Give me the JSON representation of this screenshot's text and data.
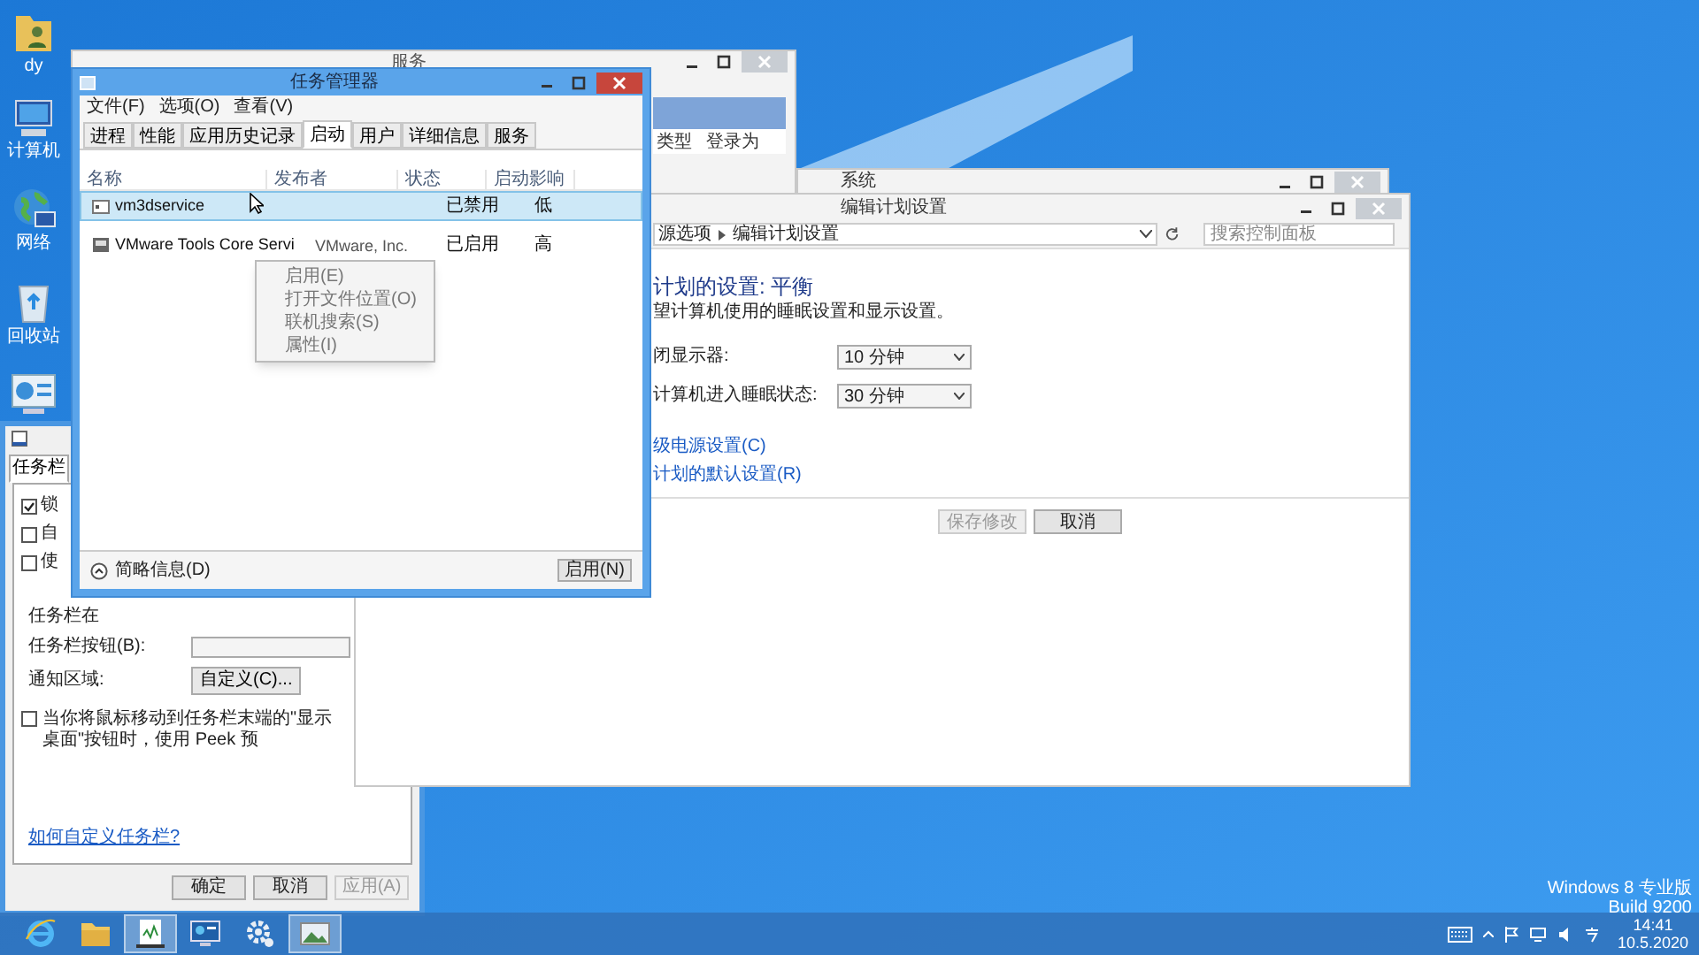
{
  "desktop_icons": [
    {
      "kind": "user-folder",
      "label": "dy"
    },
    {
      "kind": "computer",
      "label": "计算机"
    },
    {
      "kind": "network",
      "label": "网络"
    },
    {
      "kind": "recycle-bin",
      "label": "回收站"
    },
    {
      "kind": "control-panel"
    }
  ],
  "services_window": {
    "title": "服务",
    "columns": [
      "类型",
      "登录为"
    ]
  },
  "system_window": {
    "title": "系统"
  },
  "taskbar_properties": {
    "tabs": [
      {
        "label": "任务栏",
        "selected": true
      }
    ],
    "checkboxes": [
      {
        "label": "锁",
        "checked": true
      },
      {
        "label": "自",
        "checked": false
      },
      {
        "label": "使",
        "checked": false
      }
    ],
    "rows": [
      {
        "label": "任务栏在"
      },
      {
        "label": "任务栏按钮(B):"
      },
      {
        "label": "通知区域:",
        "button": "自定义(C)..."
      }
    ],
    "peek": {
      "label": "当你将鼠标移动到任务栏末端的\"显示桌面\"按钮时，使用 Peek 预",
      "checked": false
    },
    "link": "如何自定义任务栏?",
    "buttons": [
      {
        "label": "确定",
        "disabled": false
      },
      {
        "label": "取消",
        "disabled": false
      },
      {
        "label": "应用(A)",
        "disabled": true
      }
    ]
  },
  "power_window": {
    "title": "编辑计划设置",
    "breadcrumb": [
      "源选项",
      "编辑计划设置"
    ],
    "search": {
      "placeholder": "搜索控制面板"
    },
    "heading": "计划的设置: 平衡",
    "description": "望计算机使用的睡眠设置和显示设置。",
    "settings": [
      {
        "label": "闭显示器:",
        "value": "10 分钟"
      },
      {
        "label": "计算机进入睡眠状态:",
        "value": "30 分钟"
      }
    ],
    "links": [
      "级电源设置(C)",
      "计划的默认设置(R)"
    ],
    "buttons": [
      {
        "label": "保存修改",
        "disabled": true
      },
      {
        "label": "取消",
        "disabled": false
      }
    ]
  },
  "task_manager": {
    "title": "任务管理器",
    "menu": [
      "文件(F)",
      "选项(O)",
      "查看(V)"
    ],
    "tabs": [
      {
        "label": "进程",
        "selected": false
      },
      {
        "label": "性能",
        "selected": false
      },
      {
        "label": "应用历史记录",
        "selected": false
      },
      {
        "label": "启动",
        "selected": true
      },
      {
        "label": "用户",
        "selected": false
      },
      {
        "label": "详细信息",
        "selected": false
      },
      {
        "label": "服务",
        "selected": false
      }
    ],
    "columns": [
      "名称",
      "发布者",
      "状态",
      "启动影响"
    ],
    "rows": [
      {
        "kind": "generic",
        "name": "vm3dservice",
        "status": "已禁用",
        "impact": "低",
        "selected": true
      },
      {
        "kind": "vmware",
        "name": "VMware Tools Core Servi",
        "publisher": "VMware, Inc.",
        "status": "已启用",
        "impact": "高",
        "selected": false
      }
    ],
    "context_menu": [
      "启用(E)",
      "打开文件位置(O)",
      "联机搜索(S)",
      "属性(I)"
    ],
    "details_toggle": "简略信息(D)",
    "action_button": "启用(N)"
  },
  "os_label": [
    "Windows 8 专业版",
    "Build 9200"
  ],
  "taskbar": {
    "items": [
      {
        "kind": "browser",
        "active": false
      },
      {
        "kind": "folder",
        "active": false
      },
      {
        "kind": "task-manager",
        "active": true
      },
      {
        "kind": "remote-desktop",
        "active": false
      },
      {
        "kind": "gear",
        "active": false
      },
      {
        "kind": "picture",
        "active": true
      }
    ],
    "clock": {
      "time": "14:41",
      "date": "10.5.2020"
    }
  }
}
